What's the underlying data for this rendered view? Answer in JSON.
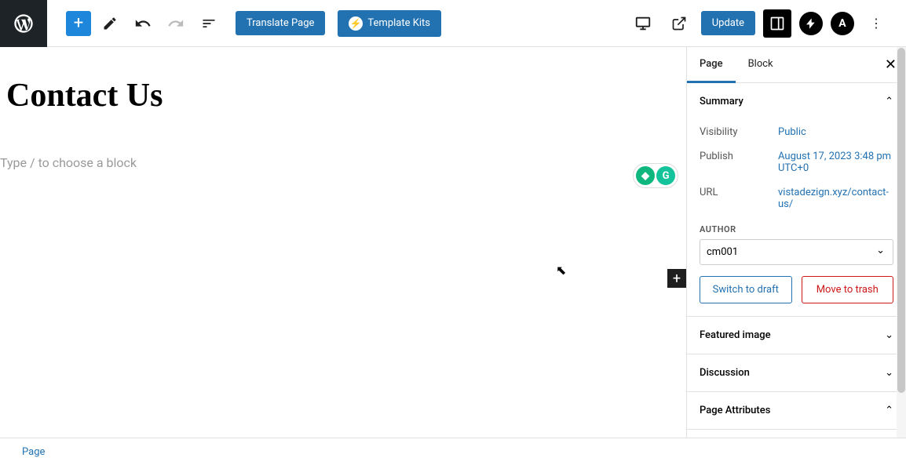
{
  "toolbar": {
    "translate_label": "Translate Page",
    "template_kits_label": "Template Kits",
    "update_label": "Update"
  },
  "editor": {
    "page_title": "Contact Us",
    "block_placeholder": "Type / to choose a block"
  },
  "sidebar": {
    "tabs": {
      "page": "Page",
      "block": "Block"
    },
    "panels": {
      "summary": {
        "title": "Summary",
        "visibility_label": "Visibility",
        "visibility_value": "Public",
        "publish_label": "Publish",
        "publish_value": "August 17, 2023 3:48 pm UTC+0",
        "url_label": "URL",
        "url_value": "vistadezign.xyz/contact-us/",
        "author_label": "AUTHOR",
        "author_value": "cm001",
        "switch_draft": "Switch to draft",
        "move_trash": "Move to trash"
      },
      "featured_image": {
        "title": "Featured image"
      },
      "discussion": {
        "title": "Discussion"
      },
      "page_attributes": {
        "title": "Page Attributes"
      }
    }
  },
  "footer": {
    "breadcrumb": "Page"
  }
}
